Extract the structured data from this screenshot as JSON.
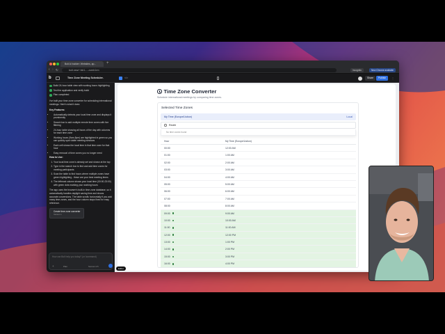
{
  "browser": {
    "tab_title": "Bolt AI builder: Websites, ap...",
    "url": "bolt.new/~/sb1-...-cvmb1rm",
    "incognito_label": "Incognito",
    "chrome_available_label": "New Chrome available"
  },
  "appbar": {
    "project_title": "Time Zone Meeting Scheduler",
    "share_label": "Share",
    "publish_label": "Publish",
    "preview_control": "Editor"
  },
  "chat": {
    "checklist": [
      "Build 24-hour table view with working hours highlighting",
      "Test the application and verify build",
      "Plan completed"
    ],
    "intro": "I've built your time zone converter for scheduling international meetings. Here's what it does:",
    "features_heading": "Key Features:",
    "features": [
      "Automatically detects your local time zone and displays it prominently",
      "Search bar to add multiple remote time zones with live filtering",
      "24-hour table showing all hours of the day with columns for each time zone",
      "Working hours (9am-5pm) are highlighted in green so you can quickly spot viable meeting windows",
      "Each cell shows the local time in that time zone for that hour",
      "Easy removal of time zones you no longer need"
    ],
    "howto_heading": "How to Use:",
    "steps": [
      "Your local time zone is already set and shown at the top",
      "Type in the search box to find and add time zones for meeting participants",
      "Scan the table to find hours where multiple zones have green highlighting - these are your best meeting times",
      "The leftmost column shows your local time (00:00-23:00) with green dots marking your working hours"
    ],
    "outro": "The app uses the browser's built-in time zone database, so it automatically handles daylight saving time and shows accurate conversions. The table scrolls horizontally if you add many time zones, and the hour column stays fixed for easy reference.",
    "task_title": "Create time zone converter",
    "task_version": "Version 1",
    "input_placeholder": "How can Bolt help you today? (or /command)",
    "input_plan_label": "Plan",
    "input_model_label": "Sonnet 4.5"
  },
  "converter": {
    "title": "Time Zone Converter",
    "subtitle": "Schedule international meetings by comparing time zones.",
    "selected_heading": "Selected Time Zones",
    "local_zone": "My Time (Europe/Lisbon)",
    "local_badge": "Local",
    "search_value": "Recife",
    "no_results": "No time zones found",
    "col_hour": "Hour",
    "col_zone": "My Time (Europe/Lisbon)",
    "rows": [
      {
        "hour": "00:00",
        "time": "12:00 AM",
        "work": false
      },
      {
        "hour": "01:00",
        "time": "1:00 AM",
        "work": false
      },
      {
        "hour": "02:00",
        "time": "2:00 AM",
        "work": false
      },
      {
        "hour": "03:00",
        "time": "3:00 AM",
        "work": false
      },
      {
        "hour": "04:00",
        "time": "4:00 AM",
        "work": false
      },
      {
        "hour": "05:00",
        "time": "5:00 AM",
        "work": false
      },
      {
        "hour": "06:00",
        "time": "6:00 AM",
        "work": false
      },
      {
        "hour": "07:00",
        "time": "7:00 AM",
        "work": false
      },
      {
        "hour": "08:00",
        "time": "8:00 AM",
        "work": false
      },
      {
        "hour": "09:00",
        "time": "9:00 AM",
        "work": true
      },
      {
        "hour": "10:00",
        "time": "10:00 AM",
        "work": true
      },
      {
        "hour": "11:00",
        "time": "11:00 AM",
        "work": true
      },
      {
        "hour": "12:00",
        "time": "12:00 PM",
        "work": true
      },
      {
        "hour": "13:00",
        "time": "1:00 PM",
        "work": true
      },
      {
        "hour": "14:00",
        "time": "2:00 PM",
        "work": true
      },
      {
        "hour": "15:00",
        "time": "3:00 PM",
        "work": true
      },
      {
        "hour": "16:00",
        "time": "4:00 PM",
        "work": true
      },
      {
        "hour": "17:00",
        "time": "5:00 PM",
        "work": true
      }
    ]
  },
  "colors": {
    "working_hour_bg": "#e3f4e3",
    "working_hour_dot": "#2a7a3a",
    "local_zone_bg": "#e9eefb",
    "publish_button": "#2f6fe0",
    "check_green": "#2fa85a"
  }
}
